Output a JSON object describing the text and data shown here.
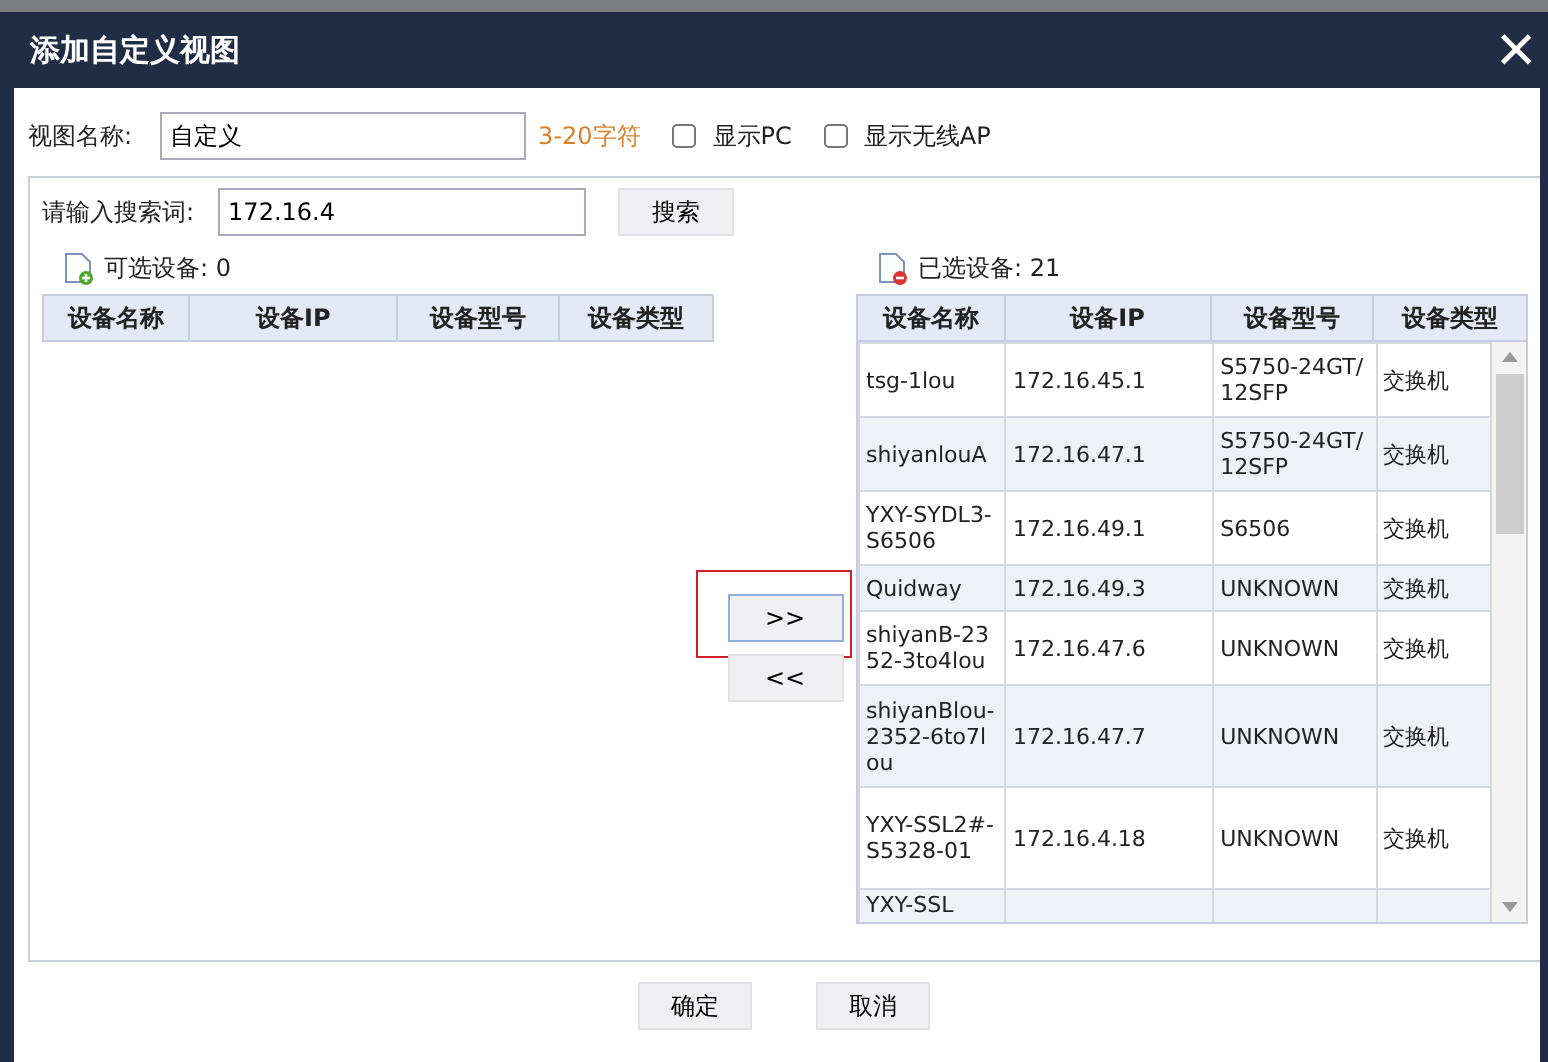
{
  "dialog": {
    "title": "添加自定义视图",
    "close": "×"
  },
  "view_name": {
    "label": "视图名称:",
    "value": "自定义",
    "hint": "3-20字符"
  },
  "options": [
    {
      "label": "显示PC",
      "checked": false
    },
    {
      "label": "显示无线AP",
      "checked": false
    }
  ],
  "search": {
    "label": "请输入搜索词:",
    "value": "172.16.4",
    "button": "搜索"
  },
  "available": {
    "title": "可选设备: 0",
    "columns": [
      "设备名称",
      "设备IP",
      "设备型号",
      "设备类型"
    ]
  },
  "transfer": [
    {
      "label": ">>",
      "highlighted": true
    },
    {
      "label": "<<",
      "highlighted": false
    }
  ],
  "selected": {
    "title": "已选设备: 21",
    "columns": [
      "设备名称",
      "设备IP",
      "设备型号",
      "设备类型"
    ],
    "rows": [
      {
        "cells": [
          "tsg-1lou",
          "172.16.45.1",
          "S5750-24GT/12SFP",
          "交换机"
        ],
        "shaded": false
      },
      {
        "cells": [
          "shiyanlouA",
          "172.16.47.1",
          "S5750-24GT/12SFP",
          "交换机"
        ],
        "shaded": true
      },
      {
        "cells": [
          "YXY-SYDL3-S6506",
          "172.16.49.1",
          "S6506",
          "交换机"
        ],
        "shaded": false
      },
      {
        "cells": [
          "Quidway",
          "172.16.49.3",
          "UNKNOWN",
          "交换机"
        ],
        "shaded": true
      },
      {
        "cells": [
          "shiyanB-2352-3to4lou",
          "172.16.47.6",
          "UNKNOWN",
          "交换机"
        ],
        "shaded": false
      },
      {
        "cells": [
          "shiyanBlou-2352-6to7lou",
          "172.16.47.7",
          "UNKNOWN",
          "交换机"
        ],
        "shaded": true
      },
      {
        "cells": [
          "YXY-SSL2#-S5328-01",
          "172.16.4.18",
          "UNKNOWN",
          "交换机"
        ],
        "shaded": false
      },
      {
        "cells": [
          "YXY-SSL",
          "",
          "",
          ""
        ],
        "shaded": true
      }
    ]
  },
  "footer": [
    "确定",
    "取消"
  ]
}
